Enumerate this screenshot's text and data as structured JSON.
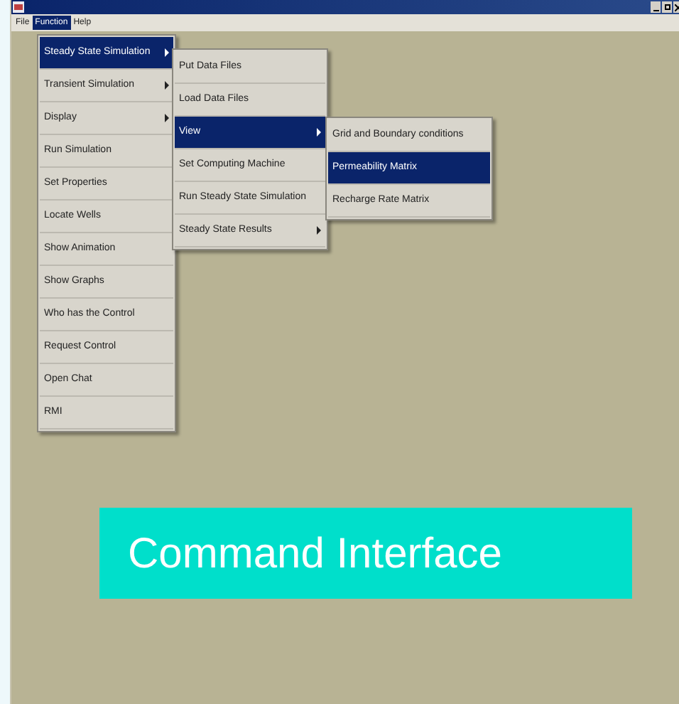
{
  "menubar": [
    {
      "label": "File",
      "selected": false
    },
    {
      "label": "Function",
      "selected": true
    },
    {
      "label": "Help",
      "selected": false
    }
  ],
  "menus": [
    {
      "items": [
        {
          "label": "Steady State Simulation",
          "submenu": true,
          "selected": true
        },
        {
          "label": "Transient Simulation",
          "submenu": true,
          "selected": false
        },
        {
          "label": "Display",
          "submenu": true,
          "selected": false
        },
        {
          "label": "Run Simulation",
          "submenu": false,
          "selected": false
        },
        {
          "label": "Set Properties",
          "submenu": false,
          "selected": false
        },
        {
          "label": "Locate Wells",
          "submenu": false,
          "selected": false
        },
        {
          "label": "Show Animation",
          "submenu": false,
          "selected": false
        },
        {
          "label": "Show Graphs",
          "submenu": false,
          "selected": false
        },
        {
          "label": "Who has the Control",
          "submenu": false,
          "selected": false
        },
        {
          "label": "Request Control",
          "submenu": false,
          "selected": false
        },
        {
          "label": "Open Chat",
          "submenu": false,
          "selected": false
        },
        {
          "label": "RMI",
          "submenu": false,
          "selected": false
        }
      ]
    },
    {
      "items": [
        {
          "label": "Put Data Files",
          "submenu": false,
          "selected": false
        },
        {
          "label": "Load Data Files",
          "submenu": false,
          "selected": false
        },
        {
          "label": "View",
          "submenu": true,
          "selected": true
        },
        {
          "label": "Set Computing Machine",
          "submenu": false,
          "selected": false
        },
        {
          "label": "Run Steady State Simulation",
          "submenu": false,
          "selected": false
        },
        {
          "label": "Steady State Results",
          "submenu": true,
          "selected": false
        }
      ]
    },
    {
      "items": [
        {
          "label": "Grid and Boundary conditions",
          "submenu": false,
          "selected": false
        },
        {
          "label": "Permeability Matrix",
          "submenu": false,
          "selected": true
        },
        {
          "label": "Recharge Rate Matrix",
          "submenu": false,
          "selected": false
        }
      ]
    }
  ],
  "caption": "Command Interface"
}
